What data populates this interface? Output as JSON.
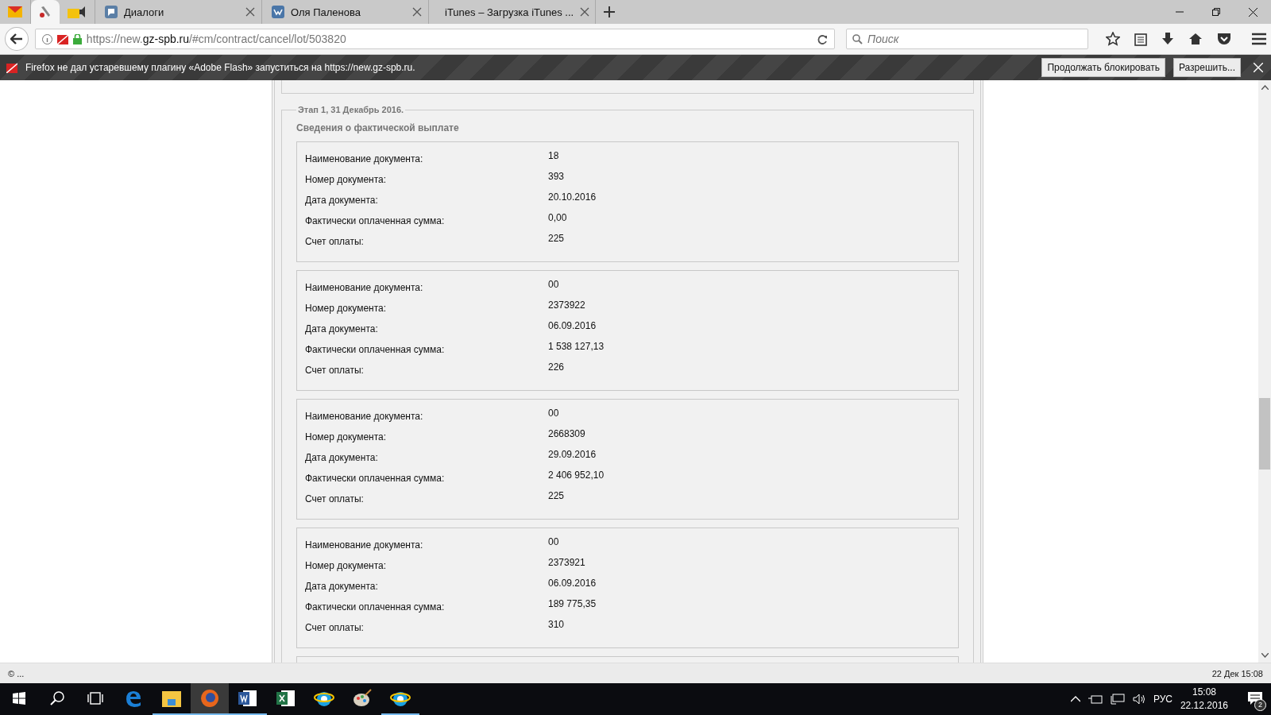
{
  "tabs": [
    {
      "kind": "mail",
      "selected": false
    },
    {
      "kind": "tools",
      "selected": true
    },
    {
      "kind": "folder",
      "selected": false
    },
    {
      "kind": "chat",
      "label": "Диалоги",
      "selected": false
    },
    {
      "kind": "vk",
      "label": "Оля Паленова",
      "selected": false
    },
    {
      "kind": "apple",
      "label": "iTunes – Загрузка iTunes ...",
      "selected": false
    }
  ],
  "address_bar": {
    "url_host": "https://new.",
    "url_domain": "gz-spb.ru",
    "url_path": "/#cm/contract/cancel/lot/503820"
  },
  "search": {
    "placeholder": "Поиск"
  },
  "notification": {
    "text": "Firefox не дал устаревшему плагину «Adobe Flash» запуститься на https://new.gz-spb.ru.",
    "buttons": [
      "Продолжать блокировать",
      "Разрешить..."
    ]
  },
  "stage": {
    "legend": "Этап 1, 31 Декабрь 2016.",
    "section_title": "Сведения о фактической выплате",
    "records": [
      {
        "fields": [
          {
            "label": "Наименование документа:",
            "value": "18"
          },
          {
            "label": "Номер документа:",
            "value": "393"
          },
          {
            "label": "Дата документа:",
            "value": "20.10.2016"
          },
          {
            "label": "Фактически оплаченная сумма:",
            "value": "0,00"
          },
          {
            "label": "Счет оплаты:",
            "value": "225"
          }
        ]
      },
      {
        "fields": [
          {
            "label": "Наименование документа:",
            "value": "00"
          },
          {
            "label": "Номер документа:",
            "value": "2373922"
          },
          {
            "label": "Дата документа:",
            "value": "06.09.2016"
          },
          {
            "label": "Фактически оплаченная сумма:",
            "value": "1 538 127,13"
          },
          {
            "label": "Счет оплаты:",
            "value": "226"
          }
        ]
      },
      {
        "fields": [
          {
            "label": "Наименование документа:",
            "value": "00"
          },
          {
            "label": "Номер документа:",
            "value": "2668309"
          },
          {
            "label": "Дата документа:",
            "value": "29.09.2016"
          },
          {
            "label": "Фактически оплаченная сумма:",
            "value": "2 406 952,10"
          },
          {
            "label": "Счет оплаты:",
            "value": "225"
          }
        ]
      },
      {
        "fields": [
          {
            "label": "Наименование документа:",
            "value": "00"
          },
          {
            "label": "Номер документа:",
            "value": "2373921"
          },
          {
            "label": "Дата документа:",
            "value": "06.09.2016"
          },
          {
            "label": "Фактически оплаченная сумма:",
            "value": "189 775,35"
          },
          {
            "label": "Счет оплаты:",
            "value": "310"
          }
        ]
      }
    ]
  },
  "status_bar": {
    "left": "© ...",
    "right": "22 Дек 15:08"
  },
  "taskbar": {
    "apps": [
      {
        "kind": "edge",
        "selected": false,
        "running": false
      },
      {
        "kind": "explorer",
        "selected": false,
        "running": true
      },
      {
        "kind": "firefox",
        "selected": true,
        "running": true
      },
      {
        "kind": "word",
        "selected": false,
        "running": true
      },
      {
        "kind": "excel",
        "selected": false,
        "running": false
      },
      {
        "kind": "ie",
        "selected": false,
        "running": false
      },
      {
        "kind": "paint",
        "selected": false,
        "running": false
      },
      {
        "kind": "ie",
        "selected": false,
        "running": true
      }
    ],
    "language": "РУС",
    "time": "15:08",
    "date": "22.12.2016",
    "notifications": "2"
  }
}
